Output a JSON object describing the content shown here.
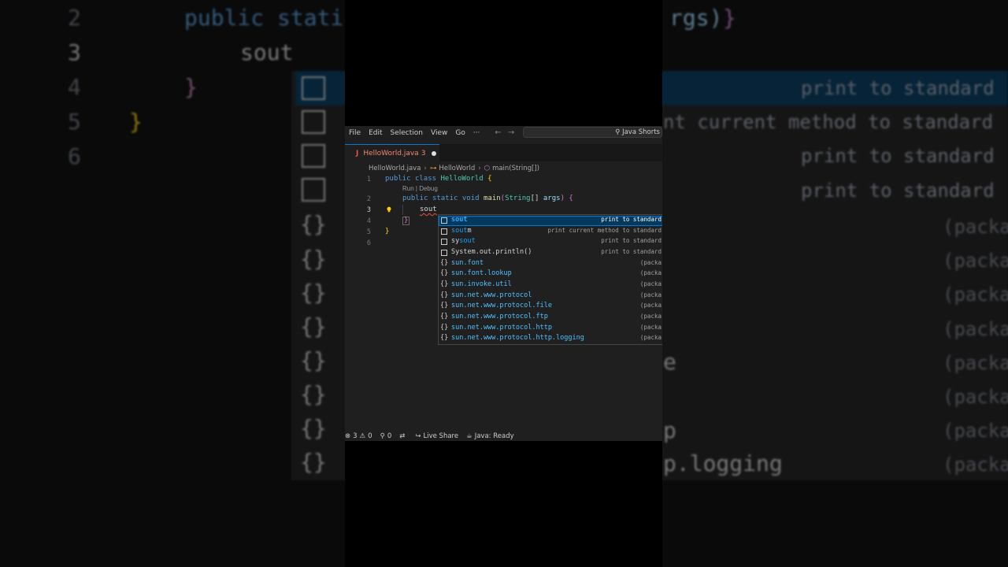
{
  "background": {
    "line_numbers": [
      "2",
      "3",
      "4",
      "5",
      "6"
    ],
    "line2_text_left": "public stati",
    "line2_text_right": "rgs)",
    "line3_text": "sout",
    "brace_close": "}",
    "brace_close_outer": "}",
    "descriptions": [
      "print to standard",
      "nt current method to standard",
      "print to standard",
      "print to standard"
    ],
    "package_label": "(packa",
    "suffixes": [
      "e",
      "p",
      "p.logging"
    ]
  },
  "titlebar": {
    "menus": [
      "File",
      "Edit",
      "Selection",
      "View",
      "Go",
      "···"
    ],
    "back_arrow": "←",
    "forward_arrow": "→",
    "command_center": "Java Shorts"
  },
  "tab": {
    "icon": "J",
    "label": "HelloWorld.java",
    "problems_count": "3"
  },
  "breadcrumb": {
    "file": "HelloWorld.java",
    "class": "HelloWorld",
    "method": "main(String[])"
  },
  "editor": {
    "line_numbers": [
      "1",
      "2",
      "3",
      "4",
      "5",
      "6"
    ],
    "line1": {
      "kw1": "public",
      "kw2": "class",
      "name": "HelloWorld",
      "brace": "{"
    },
    "codelens": "Run | Debug",
    "line2": {
      "kw1": "public",
      "kw2": "static",
      "kw3": "void",
      "fn": "main",
      "paren_open": "(",
      "type": "String",
      "arr": "[]",
      "param": "args",
      "paren_close": ")",
      "brace": "{"
    },
    "line3": {
      "text": "sout"
    },
    "line4": {
      "brace": "}"
    },
    "line5": {
      "brace": "}"
    }
  },
  "suggestions": [
    {
      "kind": "snippet",
      "match": "sout",
      "rest": "",
      "desc": "print to standard"
    },
    {
      "kind": "snippet",
      "match": "sout",
      "rest": "m",
      "desc": "print current method to standard"
    },
    {
      "kind": "snippet",
      "pre": "sy",
      "match": "sout",
      "rest": "",
      "desc": "print to standard"
    },
    {
      "kind": "snippet",
      "label": "System.out.println()",
      "desc": "print to standard"
    },
    {
      "kind": "package",
      "label": "sun.font",
      "desc": "(packa"
    },
    {
      "kind": "package",
      "label": "sun.font.lookup",
      "desc": "(packa"
    },
    {
      "kind": "package",
      "label": "sun.invoke.util",
      "desc": "(packa"
    },
    {
      "kind": "package",
      "label": "sun.net.www.protocol",
      "desc": "(packa"
    },
    {
      "kind": "package",
      "label": "sun.net.www.protocol.file",
      "desc": "(packa"
    },
    {
      "kind": "package",
      "label": "sun.net.www.protocol.ftp",
      "desc": "(packa"
    },
    {
      "kind": "package",
      "label": "sun.net.www.protocol.http",
      "desc": "(packa"
    },
    {
      "kind": "package",
      "label": "sun.net.www.protocol.http.logging",
      "desc": "(packa"
    }
  ],
  "statusbar": {
    "errors": "3",
    "warnings": "0",
    "ports": "0",
    "live_share": "Live Share",
    "java_status": "Java: Ready"
  },
  "colors": {
    "accent": "#0078d4",
    "selection": "#04395e",
    "match": "#2aaaff",
    "error": "#f14c4c"
  }
}
